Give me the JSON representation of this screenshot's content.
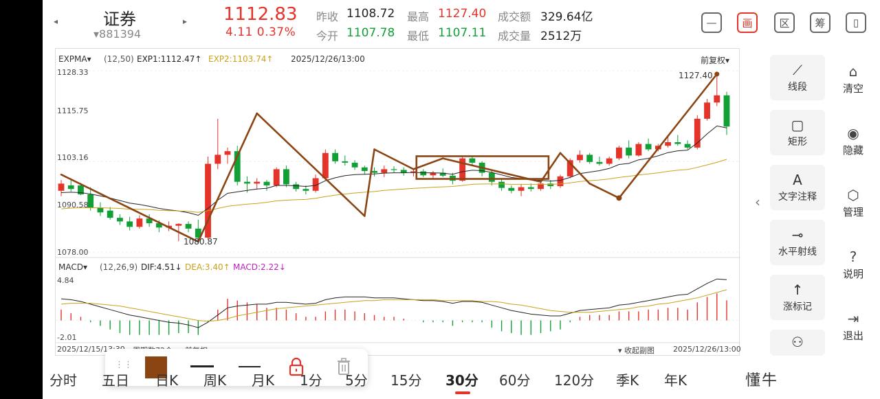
{
  "header": {
    "prev_arrow": "◂",
    "next_arrow": "▸",
    "name": "证券",
    "code": "▾881394",
    "price": "1112.83",
    "change": "4.11 0.37%",
    "quotes": [
      {
        "label": "昨收",
        "value": "1108.72",
        "tone": "neutral"
      },
      {
        "label": "今开",
        "value": "1107.78",
        "tone": "green"
      },
      {
        "label": "最高",
        "value": "1127.40",
        "tone": "red"
      },
      {
        "label": "最低",
        "value": "1107.11",
        "tone": "green"
      },
      {
        "label": "成交额",
        "value": "329.64亿",
        "tone": "neutral"
      },
      {
        "label": "成交量",
        "value": "2512万",
        "tone": "neutral"
      }
    ],
    "icons": [
      {
        "glyph": "—",
        "name": "minimize-icon"
      },
      {
        "glyph": "画",
        "name": "draw-icon"
      },
      {
        "glyph": "区",
        "name": "range-icon"
      },
      {
        "glyph": "筹",
        "name": "chips-icon"
      },
      {
        "glyph": "▯",
        "name": "fullscreen-icon"
      }
    ]
  },
  "main_chart": {
    "indicator": "EXPMA▾",
    "params": "(12,50)",
    "exp1": "EXP1:1112.47↑",
    "exp2": "EXP2:1103.74↑",
    "datetime": "2025/12/26/13:00",
    "adjust": "前复权▾",
    "y_ticks": [
      "1128.33",
      "1115.75",
      "1103.16",
      "1090.58",
      "1078.00"
    ],
    "high_label": "1127.40",
    "low_label": "1080.87"
  },
  "sub_chart": {
    "indicator": "MACD▾",
    "params": "(12,26,9)",
    "dif": "DIF:4.51↓",
    "dea": "DEA:3.40↑",
    "macd": "MACD:2.22↓",
    "y_top": "4.84",
    "y_bottom": "-2.01"
  },
  "footer": {
    "start": "2025/12/15/13:30",
    "count": "周期数72个",
    "adjust": "前复权",
    "collapse": "▾ 收起副图",
    "end": "2025/12/26/13:00"
  },
  "colors": {
    "up": "#e6332a",
    "down": "#11a036",
    "drawing": "#8b4513",
    "exp1": "#222222",
    "exp2": "#c9a217"
  },
  "chart_data": {
    "type": "candlestick",
    "interval": "30分",
    "ylim": [
      1078.0,
      1128.33
    ],
    "candles": [
      {
        "o": 1095.0,
        "h": 1098.0,
        "l": 1093.5,
        "c": 1097.0
      },
      {
        "o": 1096.5,
        "h": 1098.5,
        "l": 1094.8,
        "c": 1095.5
      },
      {
        "o": 1096.5,
        "h": 1097.2,
        "l": 1093.8,
        "c": 1094.0
      },
      {
        "o": 1094.0,
        "h": 1096.0,
        "l": 1089.5,
        "c": 1090.3
      },
      {
        "o": 1090.3,
        "h": 1091.8,
        "l": 1088.0,
        "c": 1089.0
      },
      {
        "o": 1089.5,
        "h": 1090.5,
        "l": 1087.0,
        "c": 1087.5
      },
      {
        "o": 1087.5,
        "h": 1088.5,
        "l": 1085.5,
        "c": 1086.5
      },
      {
        "o": 1086.5,
        "h": 1087.8,
        "l": 1084.0,
        "c": 1085.0
      },
      {
        "o": 1085.0,
        "h": 1088.2,
        "l": 1084.5,
        "c": 1087.3
      },
      {
        "o": 1087.3,
        "h": 1088.5,
        "l": 1085.0,
        "c": 1086.0
      },
      {
        "o": 1086.0,
        "h": 1086.8,
        "l": 1083.5,
        "c": 1084.8
      },
      {
        "o": 1084.8,
        "h": 1086.5,
        "l": 1083.8,
        "c": 1085.3
      },
      {
        "o": 1085.3,
        "h": 1086.0,
        "l": 1081.0,
        "c": 1085.8
      },
      {
        "o": 1085.8,
        "h": 1086.5,
        "l": 1083.5,
        "c": 1084.5
      },
      {
        "o": 1084.5,
        "h": 1087.0,
        "l": 1081.0,
        "c": 1082.0
      },
      {
        "o": 1082.0,
        "h": 1104.5,
        "l": 1081.5,
        "c": 1102.5
      },
      {
        "o": 1102.5,
        "h": 1115.0,
        "l": 1101.0,
        "c": 1105.0
      },
      {
        "o": 1105.0,
        "h": 1107.0,
        "l": 1102.5,
        "c": 1106.0
      },
      {
        "o": 1106.0,
        "h": 1107.5,
        "l": 1096.5,
        "c": 1097.5
      },
      {
        "o": 1097.5,
        "h": 1099.0,
        "l": 1094.5,
        "c": 1097.0
      },
      {
        "o": 1097.0,
        "h": 1098.5,
        "l": 1095.5,
        "c": 1097.5
      },
      {
        "o": 1097.5,
        "h": 1098.0,
        "l": 1095.0,
        "c": 1096.5
      },
      {
        "o": 1096.5,
        "h": 1101.5,
        "l": 1096.0,
        "c": 1101.0
      },
      {
        "o": 1101.0,
        "h": 1102.0,
        "l": 1096.0,
        "c": 1096.8
      },
      {
        "o": 1096.8,
        "h": 1097.5,
        "l": 1094.8,
        "c": 1095.5
      },
      {
        "o": 1095.5,
        "h": 1096.5,
        "l": 1094.0,
        "c": 1095.0
      },
      {
        "o": 1095.0,
        "h": 1099.5,
        "l": 1094.5,
        "c": 1098.5
      },
      {
        "o": 1098.5,
        "h": 1106.5,
        "l": 1098.0,
        "c": 1105.5
      },
      {
        "o": 1105.5,
        "h": 1106.5,
        "l": 1102.5,
        "c": 1103.2
      },
      {
        "o": 1103.2,
        "h": 1104.8,
        "l": 1102.0,
        "c": 1102.8
      },
      {
        "o": 1102.8,
        "h": 1103.5,
        "l": 1100.8,
        "c": 1101.5
      },
      {
        "o": 1101.5,
        "h": 1102.0,
        "l": 1099.5,
        "c": 1100.5
      },
      {
        "o": 1100.5,
        "h": 1101.5,
        "l": 1099.0,
        "c": 1100.0
      },
      {
        "o": 1100.0,
        "h": 1102.0,
        "l": 1098.8,
        "c": 1101.0
      },
      {
        "o": 1101.0,
        "h": 1101.8,
        "l": 1100.0,
        "c": 1100.8
      },
      {
        "o": 1100.8,
        "h": 1101.5,
        "l": 1099.2,
        "c": 1100.0
      },
      {
        "o": 1100.0,
        "h": 1101.0,
        "l": 1099.0,
        "c": 1100.4
      },
      {
        "o": 1100.4,
        "h": 1101.0,
        "l": 1098.8,
        "c": 1099.3
      },
      {
        "o": 1099.3,
        "h": 1100.5,
        "l": 1098.5,
        "c": 1100.0
      },
      {
        "o": 1100.0,
        "h": 1101.2,
        "l": 1098.8,
        "c": 1099.2
      },
      {
        "o": 1099.2,
        "h": 1100.0,
        "l": 1096.8,
        "c": 1097.8
      },
      {
        "o": 1097.8,
        "h": 1104.5,
        "l": 1097.5,
        "c": 1104.0
      },
      {
        "o": 1104.0,
        "h": 1104.5,
        "l": 1102.0,
        "c": 1102.8
      },
      {
        "o": 1102.8,
        "h": 1103.2,
        "l": 1099.0,
        "c": 1100.0
      },
      {
        "o": 1100.0,
        "h": 1100.8,
        "l": 1096.5,
        "c": 1097.5
      },
      {
        "o": 1097.5,
        "h": 1098.2,
        "l": 1095.0,
        "c": 1095.8
      },
      {
        "o": 1095.8,
        "h": 1096.5,
        "l": 1094.3,
        "c": 1095.0
      },
      {
        "o": 1095.0,
        "h": 1096.8,
        "l": 1093.5,
        "c": 1096.0
      },
      {
        "o": 1096.0,
        "h": 1097.0,
        "l": 1094.8,
        "c": 1095.5
      },
      {
        "o": 1095.5,
        "h": 1097.5,
        "l": 1095.0,
        "c": 1097.0
      },
      {
        "o": 1097.0,
        "h": 1098.0,
        "l": 1095.5,
        "c": 1096.3
      },
      {
        "o": 1096.3,
        "h": 1099.5,
        "l": 1095.8,
        "c": 1099.0
      },
      {
        "o": 1099.0,
        "h": 1104.0,
        "l": 1098.5,
        "c": 1103.5
      },
      {
        "o": 1103.5,
        "h": 1106.2,
        "l": 1102.8,
        "c": 1105.0
      },
      {
        "o": 1105.0,
        "h": 1105.5,
        "l": 1102.5,
        "c": 1103.0
      },
      {
        "o": 1103.0,
        "h": 1104.5,
        "l": 1102.0,
        "c": 1102.5
      },
      {
        "o": 1102.5,
        "h": 1104.5,
        "l": 1102.0,
        "c": 1104.0
      },
      {
        "o": 1104.0,
        "h": 1107.5,
        "l": 1103.5,
        "c": 1107.0
      },
      {
        "o": 1107.0,
        "h": 1109.0,
        "l": 1104.0,
        "c": 1104.8
      },
      {
        "o": 1104.8,
        "h": 1108.5,
        "l": 1104.5,
        "c": 1108.0
      },
      {
        "o": 1108.0,
        "h": 1109.5,
        "l": 1106.0,
        "c": 1106.5
      },
      {
        "o": 1106.5,
        "h": 1108.0,
        "l": 1106.0,
        "c": 1107.5
      },
      {
        "o": 1107.5,
        "h": 1110.0,
        "l": 1107.0,
        "c": 1108.5
      },
      {
        "o": 1108.5,
        "h": 1110.5,
        "l": 1107.5,
        "c": 1108.0
      },
      {
        "o": 1108.0,
        "h": 1109.0,
        "l": 1106.5,
        "c": 1107.0
      },
      {
        "o": 1107.0,
        "h": 1116.0,
        "l": 1106.5,
        "c": 1115.0
      },
      {
        "o": 1115.0,
        "h": 1120.5,
        "l": 1114.5,
        "c": 1119.5
      },
      {
        "o": 1119.5,
        "h": 1127.4,
        "l": 1118.5,
        "c": 1121.5
      },
      {
        "o": 1121.5,
        "h": 1122.5,
        "l": 1110.5,
        "c": 1112.83
      }
    ],
    "exp1": [
      1094.5,
      1094.6,
      1094.5,
      1094.1,
      1093.6,
      1093.0,
      1092.3,
      1091.6,
      1091.2,
      1090.7,
      1090.1,
      1089.7,
      1089.4,
      1088.9,
      1088.2,
      1090.1,
      1092.4,
      1094.3,
      1094.7,
      1095.1,
      1095.5,
      1095.7,
      1096.5,
      1096.5,
      1096.4,
      1096.2,
      1096.5,
      1097.8,
      1098.6,
      1099.2,
      1099.5,
      1099.6,
      1099.7,
      1099.9,
      1100.0,
      1100.0,
      1100.1,
      1100.0,
      1100.0,
      1099.9,
      1099.6,
      1100.3,
      1100.7,
      1100.6,
      1100.1,
      1099.4,
      1098.7,
      1098.4,
      1098.0,
      1097.9,
      1097.7,
      1097.9,
      1098.7,
      1099.8,
      1100.2,
      1100.6,
      1101.2,
      1102.3,
      1102.6,
      1103.6,
      1104.0,
      1104.7,
      1105.6,
      1106.1,
      1106.3,
      1108.3,
      1110.8,
      1113.0,
      1112.47
    ],
    "exp2": [
      1090.0,
      1090.2,
      1090.3,
      1090.3,
      1090.3,
      1090.2,
      1090.1,
      1089.9,
      1089.9,
      1089.8,
      1089.6,
      1089.5,
      1089.4,
      1089.3,
      1089.0,
      1089.5,
      1090.1,
      1090.7,
      1091.0,
      1091.3,
      1091.5,
      1091.8,
      1092.2,
      1092.4,
      1092.5,
      1092.6,
      1092.9,
      1093.4,
      1093.8,
      1094.1,
      1094.4,
      1094.6,
      1094.8,
      1095.1,
      1095.3,
      1095.5,
      1095.7,
      1095.8,
      1096.0,
      1096.1,
      1096.2,
      1096.5,
      1096.8,
      1096.9,
      1096.9,
      1096.9,
      1096.8,
      1096.8,
      1096.8,
      1096.8,
      1096.8,
      1096.9,
      1097.2,
      1097.6,
      1097.8,
      1098.0,
      1098.3,
      1098.7,
      1099.0,
      1099.4,
      1099.7,
      1100.0,
      1100.4,
      1100.7,
      1100.9,
      1101.5,
      1102.2,
      1102.9,
      1103.74
    ],
    "macd": {
      "ylim": [
        -2.01,
        4.84
      ],
      "dif": [
        2.4,
        2.3,
        2.1,
        1.8,
        1.5,
        1.2,
        0.9,
        0.6,
        0.4,
        0.2,
        0.0,
        -0.2,
        -0.3,
        -0.5,
        -0.8,
        -0.2,
        0.6,
        1.4,
        1.6,
        1.7,
        1.8,
        1.8,
        2.0,
        2.0,
        1.9,
        1.8,
        1.9,
        2.3,
        2.5,
        2.6,
        2.6,
        2.6,
        2.5,
        2.5,
        2.5,
        2.4,
        2.3,
        2.2,
        2.2,
        2.1,
        1.9,
        2.1,
        2.1,
        2.0,
        1.7,
        1.4,
        1.1,
        0.9,
        0.7,
        0.6,
        0.5,
        0.5,
        0.8,
        1.1,
        1.2,
        1.3,
        1.4,
        1.7,
        1.8,
        2.0,
        2.2,
        2.4,
        2.6,
        2.8,
        2.9,
        3.5,
        4.1,
        4.6,
        4.51
      ],
      "dea": [
        1.8,
        1.9,
        1.9,
        1.9,
        1.8,
        1.7,
        1.6,
        1.4,
        1.2,
        1.0,
        0.8,
        0.6,
        0.4,
        0.2,
        0.0,
        -0.1,
        0.0,
        0.2,
        0.5,
        0.7,
        0.9,
        1.1,
        1.3,
        1.4,
        1.5,
        1.6,
        1.7,
        1.8,
        1.9,
        2.0,
        2.1,
        2.2,
        2.2,
        2.3,
        2.3,
        2.3,
        2.3,
        2.3,
        2.3,
        2.2,
        2.2,
        2.2,
        2.2,
        2.1,
        2.1,
        2.0,
        1.8,
        1.7,
        1.5,
        1.3,
        1.1,
        1.0,
        0.9,
        0.9,
        0.9,
        1.0,
        1.1,
        1.2,
        1.3,
        1.5,
        1.6,
        1.8,
        1.9,
        2.1,
        2.3,
        2.5,
        2.8,
        3.1,
        3.4
      ],
      "hist": [
        1.2,
        0.8,
        0.4,
        -0.2,
        -0.6,
        -1.0,
        -1.4,
        -1.6,
        -1.6,
        -1.6,
        -1.6,
        -1.6,
        -1.4,
        -1.4,
        -1.6,
        -0.2,
        1.2,
        2.4,
        2.2,
        2.0,
        1.8,
        1.4,
        1.4,
        1.2,
        0.8,
        0.4,
        0.4,
        1.0,
        1.2,
        1.2,
        1.0,
        0.8,
        0.6,
        0.4,
        0.4,
        0.2,
        0.0,
        -0.2,
        -0.2,
        -0.2,
        -0.6,
        -0.2,
        -0.2,
        -0.2,
        -0.8,
        -1.2,
        -1.4,
        -1.6,
        -1.6,
        -1.4,
        -1.2,
        -1.0,
        -0.2,
        0.4,
        0.6,
        0.6,
        0.6,
        1.0,
        1.0,
        1.0,
        1.2,
        1.2,
        1.4,
        1.4,
        1.2,
        2.0,
        2.6,
        3.0,
        2.22
      ]
    }
  },
  "float_toolbar": {
    "drag": "⋮⋮",
    "color": "#8b4513"
  },
  "tools": [
    {
      "label": "线段",
      "glyph": "⟋",
      "name": "segment-tool"
    },
    {
      "label": "矩形",
      "glyph": "▢",
      "name": "rectangle-tool"
    },
    {
      "label": "文字注释",
      "glyph": "A",
      "name": "text-tool"
    },
    {
      "label": "水平射线",
      "glyph": "⊸",
      "name": "horizontal-ray-tool"
    },
    {
      "label": "涨标记",
      "glyph": "↑",
      "name": "rise-mark-tool"
    }
  ],
  "side": [
    {
      "label": "清空",
      "glyph": "⌂",
      "name": "clear"
    },
    {
      "label": "隐藏",
      "glyph": "◉",
      "name": "hide"
    },
    {
      "label": "管理",
      "glyph": "⬡",
      "name": "manage"
    },
    {
      "label": "说明",
      "glyph": "?",
      "name": "help"
    },
    {
      "label": "退出",
      "glyph": "⇥",
      "name": "exit"
    }
  ],
  "periods": [
    "分时",
    "五日",
    "日K",
    "周K",
    "月K",
    "1分",
    "5分",
    "15分",
    "30分",
    "60分",
    "120分",
    "季K",
    "年K"
  ],
  "active_period": "30分",
  "watermark": "懂牛"
}
